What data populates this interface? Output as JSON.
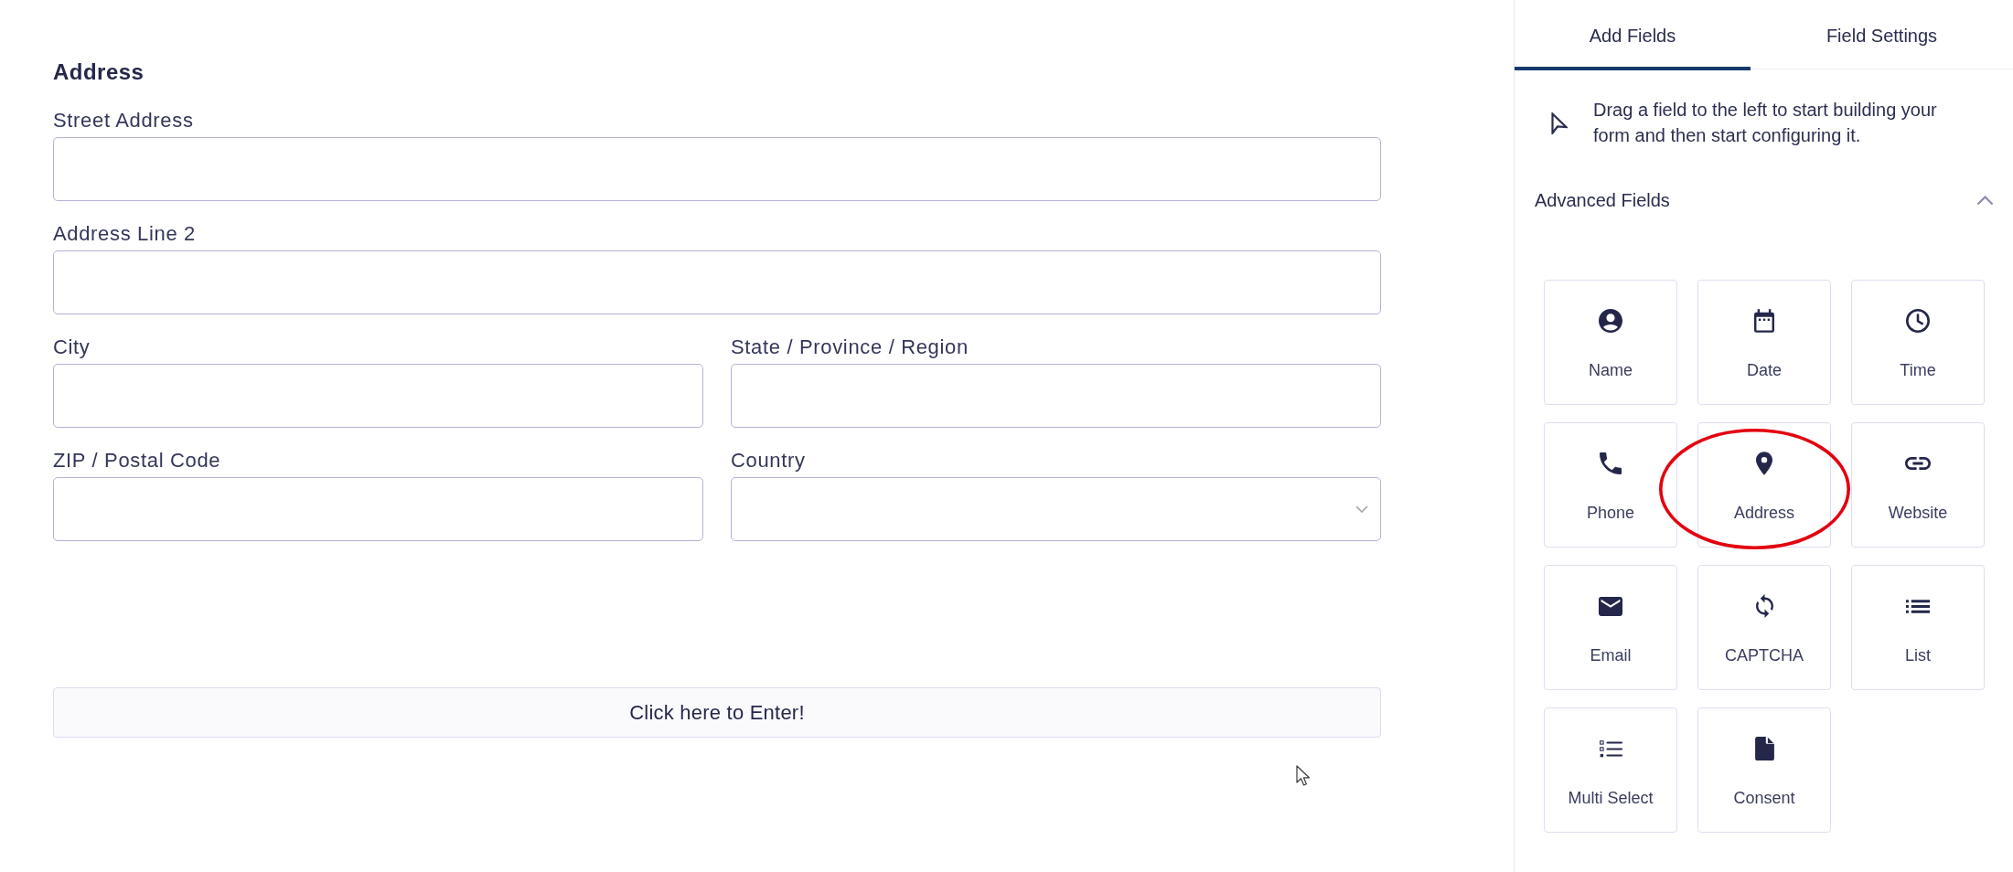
{
  "form": {
    "title": "Address",
    "rows": [
      [
        {
          "label": "Street Address",
          "kind": "text"
        }
      ],
      [
        {
          "label": "Address Line 2",
          "kind": "text"
        }
      ],
      [
        {
          "label": "City",
          "kind": "text"
        },
        {
          "label": "State / Province / Region",
          "kind": "text"
        }
      ],
      [
        {
          "label": "ZIP / Postal Code",
          "kind": "text"
        },
        {
          "label": "Country",
          "kind": "select"
        }
      ]
    ],
    "submit_button": "Click here to Enter!"
  },
  "side_panel": {
    "tabs": [
      {
        "label": "Add Fields",
        "selected": true
      },
      {
        "label": "Field Settings",
        "selected": false
      }
    ],
    "hint": "Drag a field to the left to start building your form and then start configuring it.",
    "section": {
      "title": "Advanced Fields",
      "expanded": true,
      "items": [
        {
          "label": "Name",
          "kind": "name",
          "circled": false
        },
        {
          "label": "Date",
          "kind": "date",
          "circled": false
        },
        {
          "label": "Time",
          "kind": "time",
          "circled": false
        },
        {
          "label": "Phone",
          "kind": "phone",
          "circled": false
        },
        {
          "label": "Address",
          "kind": "address",
          "circled": true
        },
        {
          "label": "Website",
          "kind": "website",
          "circled": false
        },
        {
          "label": "Email",
          "kind": "email",
          "circled": false
        },
        {
          "label": "CAPTCHA",
          "kind": "captcha",
          "circled": false
        },
        {
          "label": "List",
          "kind": "list",
          "circled": false
        },
        {
          "label": "Multi Select",
          "kind": "multiselect",
          "circled": false
        },
        {
          "label": "Consent",
          "kind": "consent",
          "circled": false
        }
      ]
    }
  }
}
